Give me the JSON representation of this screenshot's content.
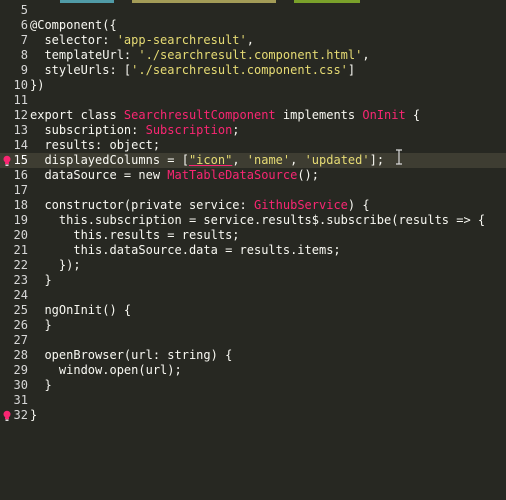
{
  "editor": {
    "lines": [
      {
        "num": "5",
        "tokens": []
      },
      {
        "num": "6",
        "tokens": [
          {
            "t": "@Component({",
            "c": "dec"
          }
        ]
      },
      {
        "num": "7",
        "tokens": [
          {
            "t": "  selector: ",
            "c": "plain"
          },
          {
            "t": "'app-searchresult'",
            "c": "str"
          },
          {
            "t": ",",
            "c": "plain"
          }
        ]
      },
      {
        "num": "8",
        "tokens": [
          {
            "t": "  templateUrl: ",
            "c": "plain"
          },
          {
            "t": "'./searchresult.component.html'",
            "c": "str"
          },
          {
            "t": ",",
            "c": "plain"
          }
        ]
      },
      {
        "num": "9",
        "tokens": [
          {
            "t": "  styleUrls: [",
            "c": "plain"
          },
          {
            "t": "'./searchresult.component.css'",
            "c": "str"
          },
          {
            "t": "]",
            "c": "plain"
          }
        ]
      },
      {
        "num": "10",
        "tokens": [
          {
            "t": "})",
            "c": "plain"
          }
        ]
      },
      {
        "num": "11",
        "tokens": []
      },
      {
        "num": "12",
        "tokens": [
          {
            "t": "export class ",
            "c": "kw"
          },
          {
            "t": "SearchresultComponent",
            "c": "type"
          },
          {
            "t": " implements ",
            "c": "kw"
          },
          {
            "t": "OnInit",
            "c": "type"
          },
          {
            "t": " {",
            "c": "plain"
          }
        ]
      },
      {
        "num": "13",
        "tokens": [
          {
            "t": "  subscription: ",
            "c": "plain"
          },
          {
            "t": "Subscription",
            "c": "type"
          },
          {
            "t": ";",
            "c": "plain"
          }
        ]
      },
      {
        "num": "14",
        "tokens": [
          {
            "t": "  results: object;",
            "c": "plain"
          }
        ]
      },
      {
        "num": "15",
        "tokens": [
          {
            "t": "  displayedColumns = [",
            "c": "plain"
          },
          {
            "t": "\"icon\"",
            "c": "str",
            "u": true
          },
          {
            "t": ", ",
            "c": "plain"
          },
          {
            "t": "'name'",
            "c": "str"
          },
          {
            "t": ", ",
            "c": "plain"
          },
          {
            "t": "'updated'",
            "c": "str"
          },
          {
            "t": "];",
            "c": "plain"
          }
        ],
        "current": true,
        "bulb": true
      },
      {
        "num": "16",
        "tokens": [
          {
            "t": "  dataSource = new ",
            "c": "plain"
          },
          {
            "t": "MatTableDataSource",
            "c": "type"
          },
          {
            "t": "();",
            "c": "plain"
          }
        ]
      },
      {
        "num": "17",
        "tokens": []
      },
      {
        "num": "18",
        "tokens": [
          {
            "t": "  constructor(private service: ",
            "c": "plain"
          },
          {
            "t": "GithubService",
            "c": "type"
          },
          {
            "t": ") {",
            "c": "plain"
          }
        ]
      },
      {
        "num": "19",
        "tokens": [
          {
            "t": "    this.subscription = service.results$.subscribe(results => {",
            "c": "plain"
          }
        ]
      },
      {
        "num": "20",
        "tokens": [
          {
            "t": "      this.results = results;",
            "c": "plain"
          }
        ]
      },
      {
        "num": "21",
        "tokens": [
          {
            "t": "      this.dataSource.data = results.items;",
            "c": "plain"
          }
        ]
      },
      {
        "num": "22",
        "tokens": [
          {
            "t": "    });",
            "c": "plain"
          }
        ]
      },
      {
        "num": "23",
        "tokens": [
          {
            "t": "  }",
            "c": "plain"
          }
        ]
      },
      {
        "num": "24",
        "tokens": []
      },
      {
        "num": "25",
        "tokens": [
          {
            "t": "  ngOnInit() {",
            "c": "plain"
          }
        ]
      },
      {
        "num": "26",
        "tokens": [
          {
            "t": "  }",
            "c": "plain"
          }
        ]
      },
      {
        "num": "27",
        "tokens": []
      },
      {
        "num": "28",
        "tokens": [
          {
            "t": "  openBrowser(url: string) {",
            "c": "plain"
          }
        ]
      },
      {
        "num": "29",
        "tokens": [
          {
            "t": "    window.open(url);",
            "c": "plain"
          }
        ]
      },
      {
        "num": "30",
        "tokens": [
          {
            "t": "  }",
            "c": "plain"
          }
        ]
      },
      {
        "num": "31",
        "tokens": []
      },
      {
        "num": "32",
        "tokens": [
          {
            "t": "}",
            "c": "plain"
          }
        ],
        "bulb": true
      }
    ]
  },
  "icons": {
    "lightbulb": "lightbulb-icon",
    "text_cursor": "text-cursor-icon"
  },
  "colors": {
    "background": "#272822",
    "current_line": "#3e3d32",
    "text": "#f8f8f2",
    "string": "#e6db74",
    "type": "#f92672",
    "gutter": "#d7d7d7"
  }
}
